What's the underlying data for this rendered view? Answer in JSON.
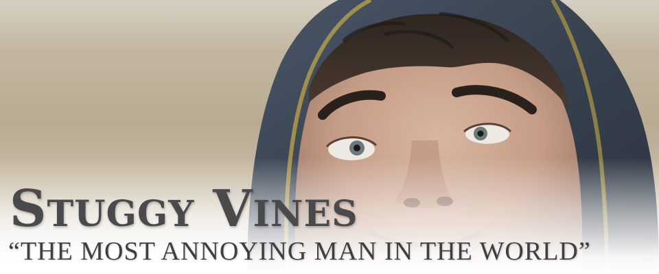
{
  "banner": {
    "title": "Stuggy Vines",
    "tagline": "“THE MOST ANNOYING MAN IN THE WORLD”"
  },
  "photo": {
    "subject_icon": "hooded-man-face-photo",
    "hood_color": "#3e4a58",
    "skin_color": "#c9a48e",
    "background_color": "#c2b6a0"
  }
}
